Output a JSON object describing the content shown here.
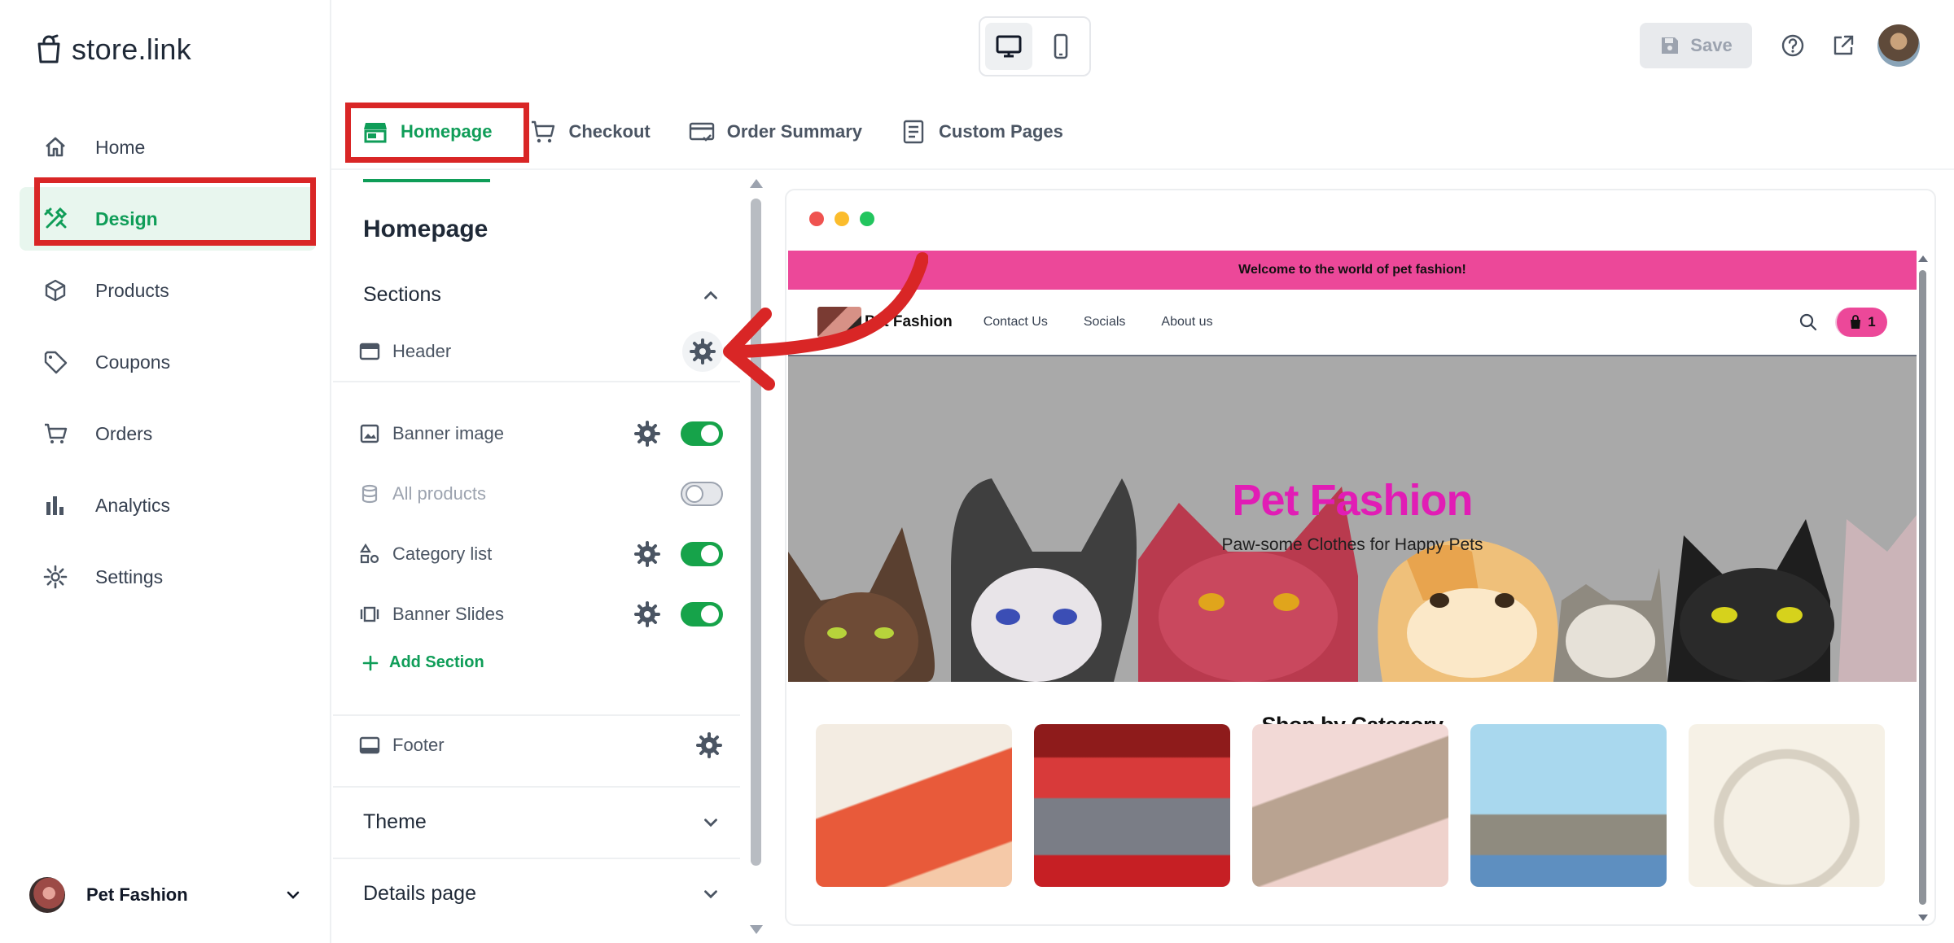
{
  "app": {
    "logo_text": "store.link"
  },
  "sidebar": {
    "items": [
      {
        "label": "Home",
        "icon": "home-icon",
        "active": false
      },
      {
        "label": "Design",
        "icon": "design-icon",
        "active": true
      },
      {
        "label": "Products",
        "icon": "box-icon",
        "active": false
      },
      {
        "label": "Coupons",
        "icon": "tag-icon",
        "active": false
      },
      {
        "label": "Orders",
        "icon": "cart-icon",
        "active": false
      },
      {
        "label": "Analytics",
        "icon": "bar-chart-icon",
        "active": false
      },
      {
        "label": "Settings",
        "icon": "gear-icon",
        "active": false
      }
    ],
    "store_name": "Pet Fashion"
  },
  "topbar": {
    "view_modes": [
      "desktop",
      "mobile"
    ],
    "active_view": "desktop",
    "save_label": "Save"
  },
  "tabs": [
    {
      "label": "Homepage",
      "active": true
    },
    {
      "label": "Checkout",
      "active": false
    },
    {
      "label": "Order Summary",
      "active": false
    },
    {
      "label": "Custom Pages",
      "active": false
    }
  ],
  "panel": {
    "title": "Homepage",
    "sections_label": "Sections",
    "header_label": "Header",
    "items": [
      {
        "label": "Banner image",
        "enabled": true,
        "configurable": true
      },
      {
        "label": "All products",
        "enabled": false,
        "configurable": false
      },
      {
        "label": "Category list",
        "enabled": true,
        "configurable": true
      },
      {
        "label": "Banner Slides",
        "enabled": true,
        "configurable": true
      }
    ],
    "add_section_label": "Add Section",
    "footer_label": "Footer",
    "theme_label": "Theme",
    "details_label": "Details page"
  },
  "preview": {
    "announcement": "Welcome to the world of pet fashion!",
    "brand": "Pet Fashion",
    "nav_links": [
      "Contact Us",
      "Socials",
      "About us"
    ],
    "cart_count": "1",
    "hero_title": "Pet Fashion",
    "hero_subtitle": "Paw-some Clothes for Happy Pets",
    "category_heading": "Shop by Category",
    "colors": {
      "accent_pink": "#ec4899",
      "hero_title": "#e11db5",
      "brand_green": "#0f9d58",
      "highlight_red": "#d92626"
    }
  }
}
